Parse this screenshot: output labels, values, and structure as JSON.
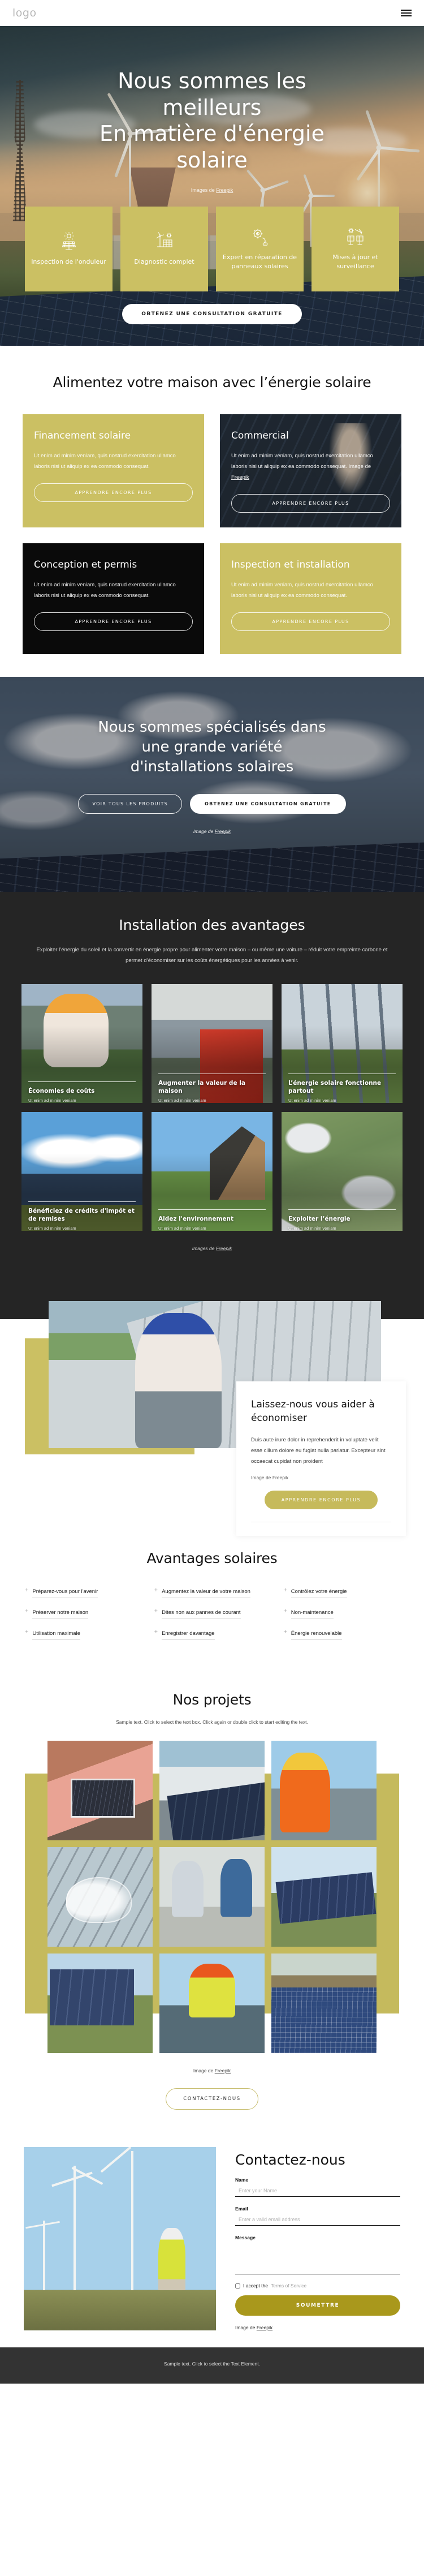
{
  "header": {
    "logo": "logo",
    "menu_icon": "hamburger-menu-icon"
  },
  "hero": {
    "title_line1": "Nous sommes les",
    "title_line2": "meilleurs",
    "title_line3": "En matière d'énergie",
    "title_line4": "solaire",
    "credit_prefix": "Images de ",
    "credit_link": "Freepik",
    "cta": "OBTENEZ UNE CONSULTATION GRATUITE",
    "services": [
      {
        "icon": "solar-panel-sun-icon",
        "label": "Inspection de l'onduleur"
      },
      {
        "icon": "wind-turbine-panel-icon",
        "label": "Diagnostic complet"
      },
      {
        "icon": "gear-plug-icon",
        "label": "Expert en réparation de panneaux solaires"
      },
      {
        "icon": "solar-monitoring-icon",
        "label": "Mises à jour et surveillance"
      }
    ]
  },
  "features": {
    "heading": "Alimentez votre maison avec l’énergie solaire",
    "body_text": "Ut enim ad minim veniam, quis nostrud exercitation ullamco laboris nisi ut aliquip ex ea commodo consequat.",
    "body_text_credit": "Ut enim ad minim veniam, quis nostrud exercitation ullamco laboris nisi ut aliquip ex ea commodo consequat. Image de ",
    "credit_link": "Freepik",
    "button": "APPRENDRE ENCORE PLUS",
    "cards": [
      {
        "title": "Financement solaire",
        "style": "gold"
      },
      {
        "title": "Commercial",
        "style": "photo"
      },
      {
        "title": "Conception et permis",
        "style": "black"
      },
      {
        "title": "Inspection et installation",
        "style": "gold"
      }
    ]
  },
  "banner": {
    "title_line1": "Nous sommes spécialisés dans",
    "title_line2": "une grande variété",
    "title_line3": "d'installations solaires",
    "btn_products": "VOIR TOUS LES PRODUITS",
    "btn_consult": "OBTENEZ UNE CONSULTATION GRATUITE",
    "credit_prefix": "Image de ",
    "credit_link": "Freepik"
  },
  "benefits": {
    "heading": "Installation des avantages",
    "lead": "Exploiter l’énergie du soleil et la convertir en énergie propre pour alimenter votre maison – ou même une voiture – réduit votre empreinte carbone et permet d’économiser sur les coûts énergétiques pour les années à venir.",
    "credit_prefix": "Images de ",
    "credit_link": "Freepik",
    "cards": [
      {
        "title": "Économies de coûts",
        "sub": "Ut enim ad minim veniam"
      },
      {
        "title": "Augmenter la valeur de la maison",
        "sub": "Ut enim ad minim veniam"
      },
      {
        "title": "L’énergie solaire fonctionne partout",
        "sub": "Ut enim ad minim veniam"
      },
      {
        "title": "Bénéficiez de crédits d'impôt et de remises",
        "sub": "Ut enim ad minim veniam"
      },
      {
        "title": "Aidez l'environnement",
        "sub": "Ut enim ad minim veniam"
      },
      {
        "title": "Exploiter l’énergie",
        "sub": "Ut enim ad minim veniam"
      }
    ]
  },
  "save": {
    "title": "Laissez-nous vous aider à économiser",
    "body": "Duis aute irure dolor in reprehenderit in voluptate velit esse cillum dolore eu fugiat nulla pariatur. Excepteur sint occaecat cupidat non proident",
    "credit_prefix": "Image de ",
    "credit_link": "Freepik",
    "button": "APPRENDRE ENCORE PLUS"
  },
  "advantages": {
    "heading": "Avantages solaires",
    "columns": [
      [
        "Préparez-vous pour l'avenir",
        "Préserver notre maison",
        "Utilisation maximale"
      ],
      [
        "Augmentez la valeur de votre maison",
        "Dites non aux pannes de courant",
        "Enregistrer davantage"
      ],
      [
        "Contrôlez votre énergie",
        "Non-maintenance",
        "Énergie renouvelable"
      ]
    ]
  },
  "projects": {
    "heading": "Nos projets",
    "subtitle": "Sample text. Click to select the text box. Click again or double click to start editing the text.",
    "credit_prefix": "Image de ",
    "credit_link": "Freepik",
    "button": "CONTACTEZ-NOUS"
  },
  "contact": {
    "heading": "Contactez-nous",
    "name_label": "Name",
    "name_placeholder": "Enter your Name",
    "email_label": "Email",
    "email_placeholder": "Enter a valid email address",
    "message_label": "Message",
    "message_placeholder": "",
    "terms_prefix": "I accept the ",
    "terms_link": "Terms of Service",
    "submit": "SOUMETTRE",
    "credit_prefix": "Image de ",
    "credit_link": "Freepik"
  },
  "footer": {
    "text": "Sample text. Click to select the Text Element."
  },
  "colors": {
    "gold": "#cbc063",
    "gold_dark": "#a9981c",
    "dark": "#252525",
    "footer": "#333333",
    "black_card": "#0a0a0a"
  }
}
